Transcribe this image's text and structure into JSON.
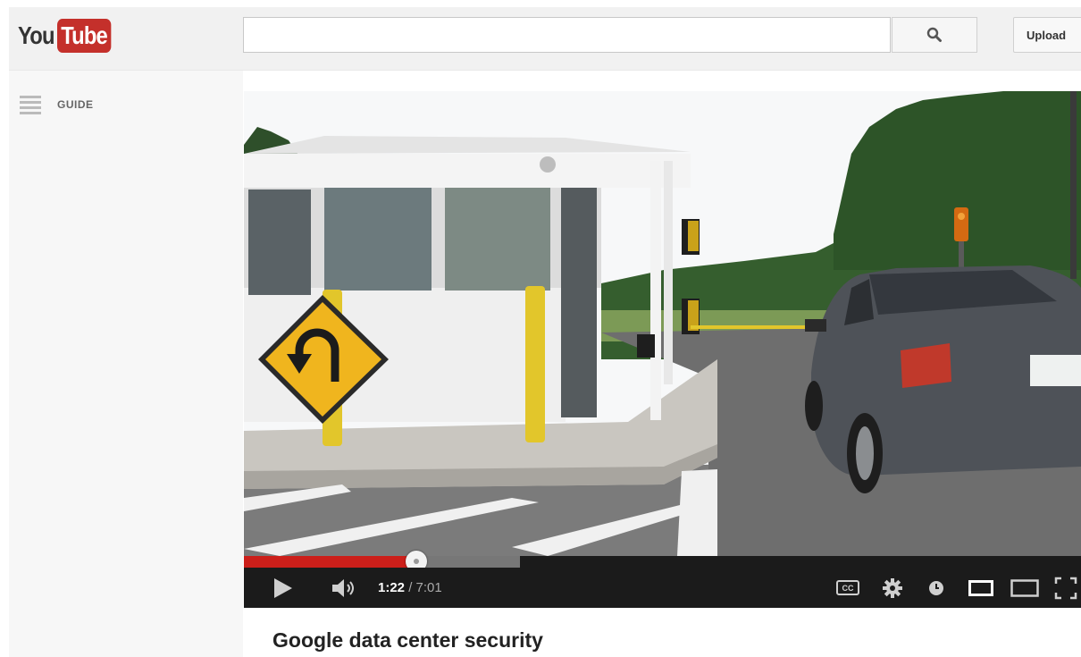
{
  "header": {
    "logo_you": "You",
    "logo_tube": "Tube",
    "search_value": "",
    "upload_label": "Upload"
  },
  "guide": {
    "label": "GUIDE"
  },
  "player": {
    "current_time": "1:22",
    "duration": "7:01",
    "time_separator": " / ",
    "played_fraction": 0.206,
    "buffered_fraction": 0.33,
    "cc_label": "CC"
  },
  "video": {
    "title": "Google data center security"
  },
  "colors": {
    "accent": "#cc1f1a",
    "logo_red": "#c4302b"
  }
}
